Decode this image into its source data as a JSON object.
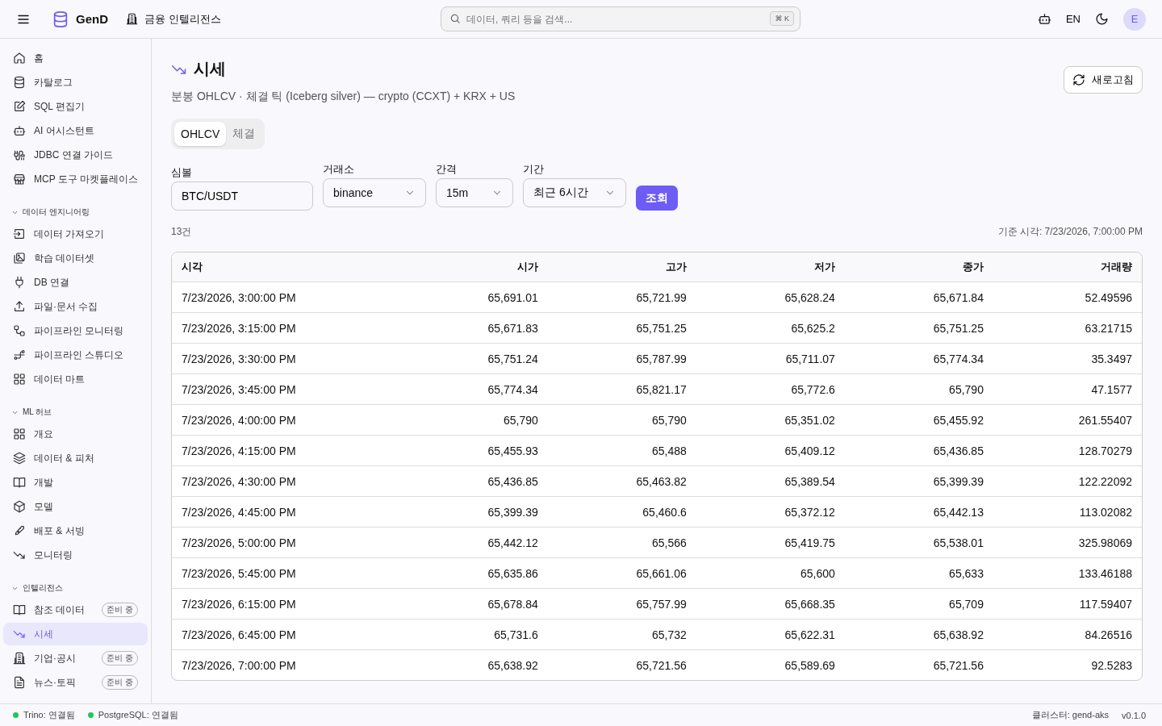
{
  "topbar": {
    "brand": "GenD",
    "workspace": "금융 인텔리전스",
    "search": {
      "placeholder": "데이터, 쿼리 등을 검색...",
      "shortcut": "⌘ K"
    },
    "language": "EN",
    "avatar": "E"
  },
  "sidebar": {
    "sections": [
      {
        "items": [
          {
            "label": "홈",
            "selected": false
          },
          {
            "label": "카탈로그",
            "selected": false
          },
          {
            "label": "SQL 편집기",
            "selected": false
          },
          {
            "label": "AI 어시스턴트",
            "selected": false
          },
          {
            "label": "JDBC 연결 가이드",
            "selected": false
          },
          {
            "label": "MCP 도구 마켓플레이스",
            "selected": false
          }
        ]
      },
      {
        "title": "데이터 엔지니어링",
        "items": [
          {
            "label": "데이터 가져오기",
            "selected": false
          },
          {
            "label": "학습 데이터셋",
            "selected": false
          },
          {
            "label": "DB 연결",
            "selected": false
          },
          {
            "label": "파일·문서 수집",
            "selected": false
          },
          {
            "label": "파이프라인 모니터링",
            "selected": false
          },
          {
            "label": "파이프라인 스튜디오",
            "selected": false
          },
          {
            "label": "데이터 마트",
            "selected": false
          }
        ]
      },
      {
        "title": "ML 허브",
        "items": [
          {
            "label": "개요",
            "selected": false
          },
          {
            "label": "데이터 & 피처",
            "selected": false
          },
          {
            "label": "개발",
            "selected": false
          },
          {
            "label": "모델",
            "selected": false
          },
          {
            "label": "배포 & 서빙",
            "selected": false
          },
          {
            "label": "모니터링",
            "selected": false
          }
        ]
      },
      {
        "title": "인텔리전스",
        "items": [
          {
            "label": "참조 데이터",
            "selected": false,
            "badge": "준비 중"
          },
          {
            "label": "시세",
            "selected": true
          },
          {
            "label": "기업·공시",
            "selected": false,
            "badge": "준비 중"
          },
          {
            "label": "뉴스·토픽",
            "selected": false,
            "badge": "준비 중"
          }
        ]
      }
    ]
  },
  "page": {
    "title": "시세",
    "subtitle": "분봉 OHLCV · 체결 틱 (Iceberg silver) — crypto (CCXT) + KRX + US",
    "refresh_button": "새로고침",
    "tabs": [
      {
        "label": "OHLCV",
        "selected": true
      },
      {
        "label": "체결",
        "selected": false
      }
    ],
    "filters": {
      "symbol": {
        "label": "심볼",
        "value": "BTC/USDT"
      },
      "exchange": {
        "label": "거래소",
        "value": "binance"
      },
      "interval": {
        "label": "간격",
        "value": "15m"
      },
      "period": {
        "label": "기간",
        "value": "최근 6시간"
      },
      "submit": "조회"
    },
    "count": "13건",
    "as_of": "기준 시각: 7/23/2026, 7:00:00 PM"
  },
  "table": {
    "columns": [
      "시각",
      "시가",
      "고가",
      "저가",
      "종가",
      "거래량"
    ],
    "rows": [
      [
        "7/23/2026, 3:00:00 PM",
        "65,691.01",
        "65,721.99",
        "65,628.24",
        "65,671.84",
        "52.49596"
      ],
      [
        "7/23/2026, 3:15:00 PM",
        "65,671.83",
        "65,751.25",
        "65,625.2",
        "65,751.25",
        "63.21715"
      ],
      [
        "7/23/2026, 3:30:00 PM",
        "65,751.24",
        "65,787.99",
        "65,711.07",
        "65,774.34",
        "35.3497"
      ],
      [
        "7/23/2026, 3:45:00 PM",
        "65,774.34",
        "65,821.17",
        "65,772.6",
        "65,790",
        "47.1577"
      ],
      [
        "7/23/2026, 4:00:00 PM",
        "65,790",
        "65,790",
        "65,351.02",
        "65,455.92",
        "261.55407"
      ],
      [
        "7/23/2026, 4:15:00 PM",
        "65,455.93",
        "65,488",
        "65,409.12",
        "65,436.85",
        "128.70279"
      ],
      [
        "7/23/2026, 4:30:00 PM",
        "65,436.85",
        "65,463.82",
        "65,389.54",
        "65,399.39",
        "122.22092"
      ],
      [
        "7/23/2026, 4:45:00 PM",
        "65,399.39",
        "65,460.6",
        "65,372.12",
        "65,442.13",
        "113.02082"
      ],
      [
        "7/23/2026, 5:00:00 PM",
        "65,442.12",
        "65,566",
        "65,419.75",
        "65,538.01",
        "325.98069"
      ],
      [
        "7/23/2026, 5:45:00 PM",
        "65,635.86",
        "65,661.06",
        "65,600",
        "65,633",
        "133.46188"
      ],
      [
        "7/23/2026, 6:15:00 PM",
        "65,678.84",
        "65,757.99",
        "65,668.35",
        "65,709",
        "117.59407"
      ],
      [
        "7/23/2026, 6:45:00 PM",
        "65,731.6",
        "65,732",
        "65,622.31",
        "65,638.92",
        "84.26516"
      ],
      [
        "7/23/2026, 7:00:00 PM",
        "65,638.92",
        "65,721.56",
        "65,589.69",
        "65,721.56",
        "92.5283"
      ]
    ]
  },
  "status_bar": {
    "connections": [
      {
        "label": "Trino: 연결됨",
        "color": "#22c55e"
      },
      {
        "label": "PostgreSQL: 연결됨",
        "color": "#22c55e"
      }
    ],
    "cluster": "클러스터: gend-aks",
    "version": "v0.1.0"
  }
}
